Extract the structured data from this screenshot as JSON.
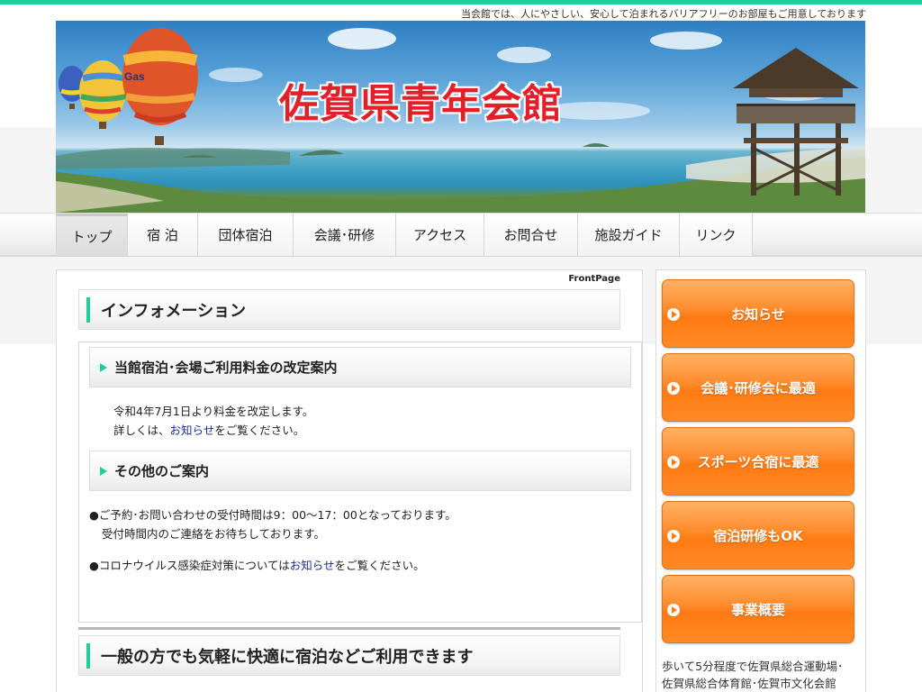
{
  "tagline": "当会館では、人にやさしい、安心して泊まれるバリアフリーのお部屋もご用意しております",
  "site_title": "佐賀県青年会館",
  "balloon_text": "Gas",
  "nav": {
    "items": [
      "トップ",
      "宿 泊",
      "団体宿泊",
      "会議･研修",
      "アクセス",
      "お問合せ",
      "施設ガイド",
      "リンク"
    ],
    "active": "トップ"
  },
  "main": {
    "frontpage_label": "FrontPage",
    "info_heading": "インフォメーション",
    "notice1": {
      "heading": "当館宿泊･会場ご利用料金の改定案内",
      "line1": "令和4年7月1日より料金を改定します。",
      "line2_before": "詳しくは、",
      "line2_link": "お知らせ",
      "line2_after": "をご覧ください。"
    },
    "notice2": {
      "heading": "その他のご案内",
      "line1": "●ご予約･お問い合わせの受付時間は9：00〜17：00となっております。",
      "line2": "受付時間内のご連絡をお待ちしております。",
      "line3_before": "●コロナウイルス感染症対策については",
      "line3_link": "お知らせ",
      "line3_after": "をご覧ください。"
    },
    "second_heading": "一般の方でも気軽に快適に宿泊などご利用できます"
  },
  "sidebar": {
    "buttons": [
      "お知らせ",
      "会議･研修会に最適",
      "スポーツ合宿に最適",
      "宿泊研修もOK",
      "事業概要"
    ],
    "text_line1": "歩いて5分程度で佐賀県総合運動場･",
    "text_line2": "佐賀県総合体育館･佐賀市文化会館"
  },
  "colors": {
    "accent": "#1ccf99",
    "title_red": "#e2202a",
    "button_orange": "#ff7a12",
    "link_blue": "#1a2fa0"
  }
}
